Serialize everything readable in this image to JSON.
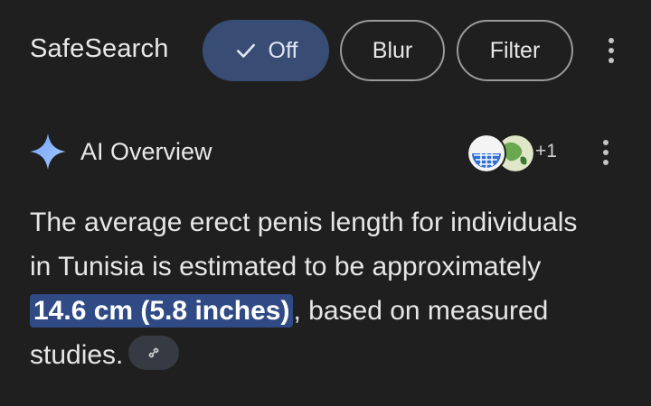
{
  "safesearch": {
    "title": "SafeSearch",
    "options": [
      {
        "label": "Off",
        "selected": true,
        "icon": "check-icon"
      },
      {
        "label": "Blur",
        "selected": false
      },
      {
        "label": "Filter",
        "selected": false
      }
    ],
    "menu_icon": "more-vert-icon"
  },
  "ai_overview": {
    "title": "AI Overview",
    "icon": "sparkle-icon",
    "sources_extra": "+1",
    "menu_icon": "more-vert-icon",
    "body": {
      "line1": "The average erect penis length for individuals",
      "line2": "in Tunisia is estimated to be approximately",
      "highlight": "14.6 cm (5.8 inches)",
      "after_highlight": ", based on measured",
      "line4": "studies."
    },
    "link_icon": "link-icon"
  },
  "colors": {
    "background": "#1f1f1f",
    "selected_chip": "#394d74",
    "highlight": "#2f4a85",
    "sparkle": "#8ab4f8"
  }
}
